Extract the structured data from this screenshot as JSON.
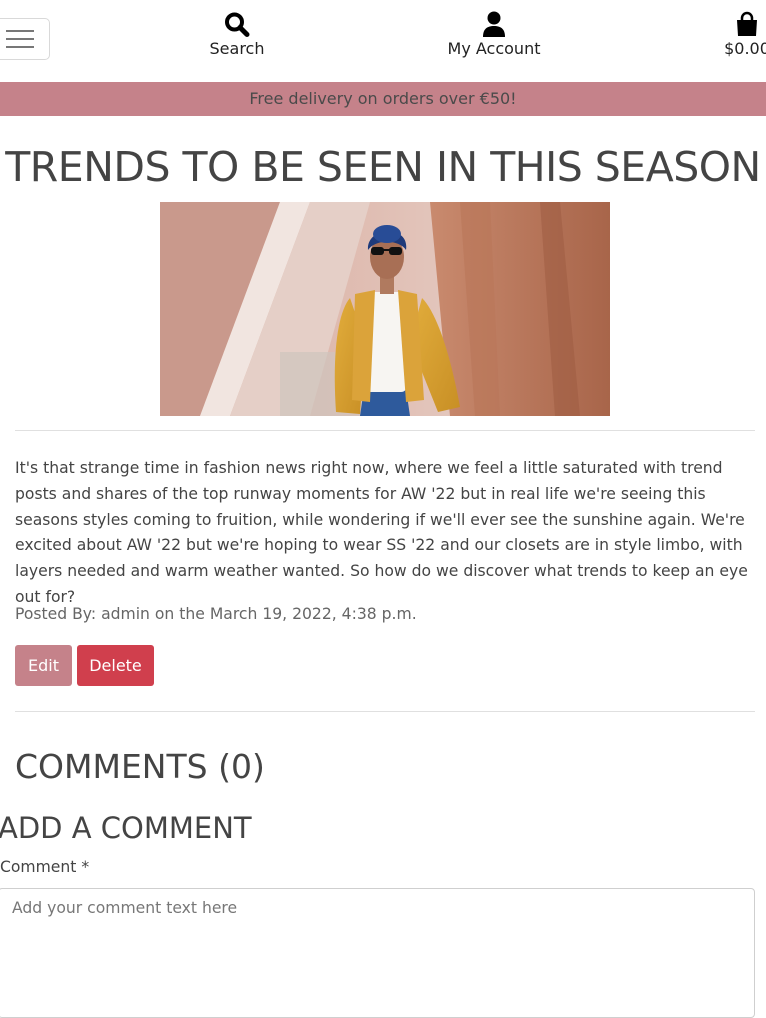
{
  "header": {
    "menu_toggle": "menu",
    "nav": [
      {
        "label": "Search",
        "icon": "search-icon"
      },
      {
        "label": "My Account",
        "icon": "user-icon"
      },
      {
        "label": "$0.00",
        "icon": "shopping-bag-icon"
      }
    ]
  },
  "banner": {
    "text": "Free delivery on orders over €50!",
    "color": "#c5828a"
  },
  "post": {
    "title": "TRENDS TO BE SEEN IN THIS SEASON",
    "image_subject": "woman in mustard jacket, blue headscarf and sunglasses",
    "body": "It's that strange time in fashion news right now, where we feel a little saturated with trend posts and shares of the top runway moments for AW '22 but in real life we're seeing this seasons styles coming to fruition, while wondering if we'll ever see the sunshine again. We're excited about AW '22 but we're hoping to wear SS '22 and our closets are in style limbo, with layers needed and warm weather wanted. So how do we discover what trends to keep an eye out for?",
    "meta": "Posted By: admin on the March 19, 2022, 4:38 p.m.",
    "edit_label": "Edit",
    "delete_label": "Delete"
  },
  "comments": {
    "heading": "COMMENTS (0)",
    "add_heading": "ADD A COMMENT",
    "field_label": "Comment *",
    "placeholder": "Add your comment text here"
  },
  "colors": {
    "accent": "#c5828a",
    "danger": "#d03f4d"
  }
}
